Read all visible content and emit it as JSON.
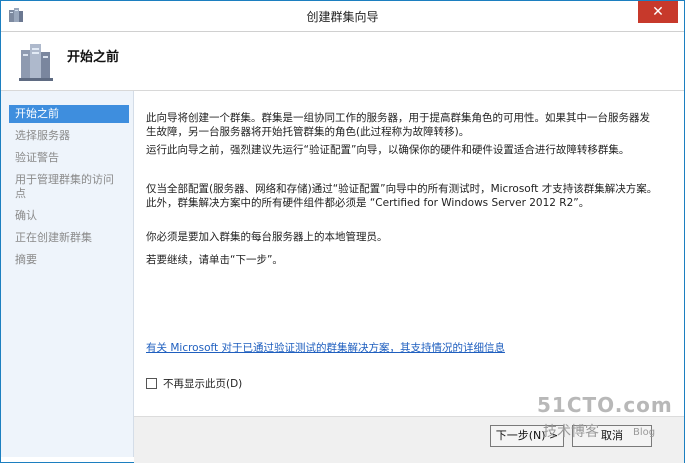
{
  "window": {
    "title": "创建群集向导",
    "close_label": "✕"
  },
  "header": {
    "title": "开始之前"
  },
  "sidebar": {
    "items": [
      {
        "label": "开始之前",
        "active": true
      },
      {
        "label": "选择服务器",
        "active": false
      },
      {
        "label": "验证警告",
        "active": false
      },
      {
        "label": "用于管理群集的访问点",
        "active": false
      },
      {
        "label": "确认",
        "active": false
      },
      {
        "label": "正在创建新群集",
        "active": false
      },
      {
        "label": "摘要",
        "active": false
      }
    ]
  },
  "content": {
    "paragraphs": [
      "此向导将创建一个群集。群集是一组协同工作的服务器，用于提高群集角色的可用性。如果其中一台服务器发生故障，另一台服务器将开始托管群集的角色(此过程称为故障转移)。",
      "运行此向导之前，强烈建议先运行“验证配置”向导，以确保你的硬件和硬件设置适合进行故障转移群集。",
      "仅当全部配置(服务器、网络和存储)通过“验证配置”向导中的所有测试时，Microsoft 才支持该群集解决方案。此外，群集解决方案中的所有硬件组件都必须是 “Certified for Windows Server 2012 R2”。",
      "你必须是要加入群集的每台服务器上的本地管理员。",
      "若要继续，请单击“下一步”。"
    ],
    "link_text": "有关 Microsoft 对于已通过验证测试的群集解决方案，其支持情况的详细信息",
    "checkbox_label": "不再显示此页(D)",
    "checkbox_checked": false
  },
  "footer": {
    "next_label": "下一步(N) >",
    "cancel_label": "取消"
  },
  "watermark": {
    "brand": "51CTO.com",
    "subtitle": "技术博客",
    "blog": "Blog"
  }
}
